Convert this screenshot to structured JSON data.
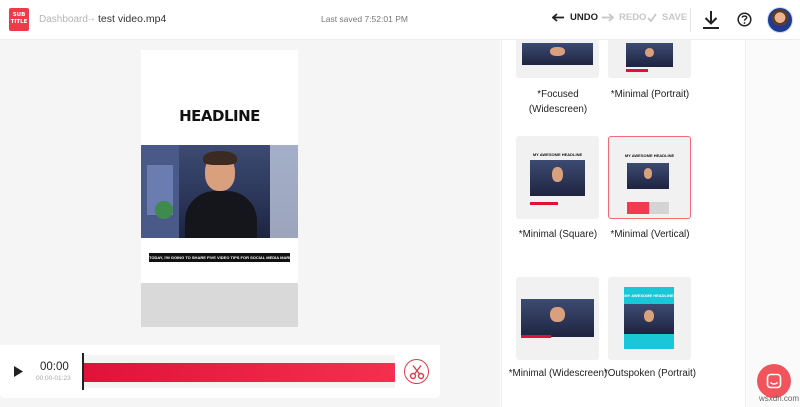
{
  "header": {
    "logo_text": "SUB TITLE",
    "breadcrumb_link": "Dashboard",
    "breadcrumb_separator": "→",
    "file_name": "test video.mp4",
    "last_saved": "Last saved 7:52:01 PM",
    "undo_label": "UNDO",
    "redo_label": "REDO",
    "save_label": "SAVE",
    "icons": [
      "undo-icon",
      "redo-icon",
      "check-icon",
      "download-icon",
      "help-icon",
      "avatar"
    ]
  },
  "canvas": {
    "headline": "HEADLINE",
    "caption": "TODAY, I'M GOING TO SHARE FIVE VIDEO TIPS FOR SOCIAL MEDIA MARKETING."
  },
  "player": {
    "current_time": "00:00",
    "range": "00:00-01:23"
  },
  "templates": [
    {
      "label": "*Focused (Widescreen)"
    },
    {
      "label": "*Minimal (Portrait)"
    },
    {
      "label": "*Minimal (Square)",
      "thumb_text": "MY AWESOME HEADLINE"
    },
    {
      "label": "*Minimal (Vertical)",
      "thumb_text": "MY AWESOME HEADLINE",
      "selected": true
    },
    {
      "label": "*Minimal (Widescreen)"
    },
    {
      "label": "*Outspoken (Portrait)",
      "thumb_text": "MY AWESOME HEADLINE"
    }
  ],
  "footer": {
    "watermark": "wsxdn.com"
  },
  "colors": {
    "accent": "#e0123a",
    "selected_border": "#f26a74",
    "chat": "#f2545b",
    "outspoken_teal": "#19c7d6"
  }
}
